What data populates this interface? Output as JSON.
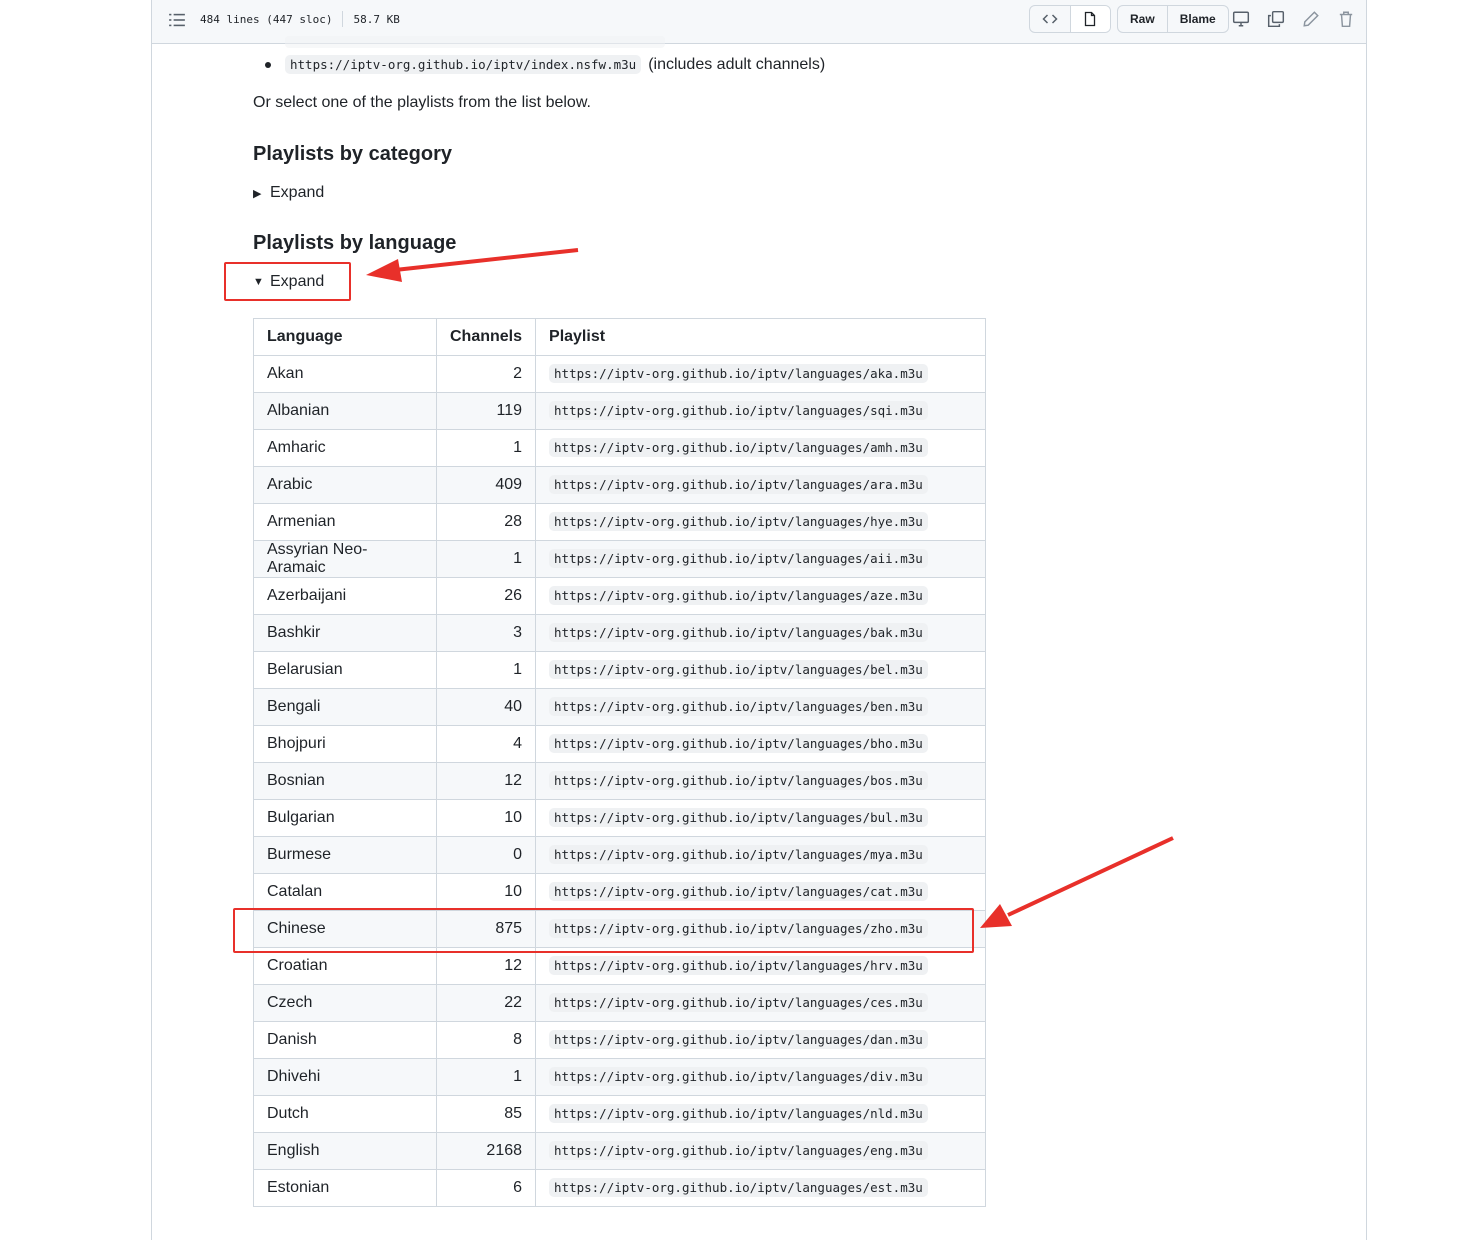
{
  "file_header": {
    "lines": "484 lines (447 sloc)",
    "size": "58.7 KB",
    "raw_label": "Raw",
    "blame_label": "Blame",
    "icons": [
      "list-icon",
      "code-icon",
      "file-icon",
      "desktop-icon",
      "copy-icon",
      "pencil-icon",
      "trash-icon"
    ]
  },
  "content": {
    "nsfw_url": "https://iptv-org.github.io/iptv/index.nsfw.m3u",
    "nsfw_note": "(includes adult channels)",
    "select_text": "Or select one of the playlists from the list below.",
    "category_heading": "Playlists by category",
    "category_expand": "Expand",
    "language_heading": "Playlists by language",
    "language_expand": "Expand"
  },
  "table": {
    "headers": [
      "Language",
      "Channels",
      "Playlist"
    ],
    "rows": [
      {
        "language": "Akan",
        "channels": "2",
        "url": "https://iptv-org.github.io/iptv/languages/aka.m3u"
      },
      {
        "language": "Albanian",
        "channels": "119",
        "url": "https://iptv-org.github.io/iptv/languages/sqi.m3u"
      },
      {
        "language": "Amharic",
        "channels": "1",
        "url": "https://iptv-org.github.io/iptv/languages/amh.m3u"
      },
      {
        "language": "Arabic",
        "channels": "409",
        "url": "https://iptv-org.github.io/iptv/languages/ara.m3u"
      },
      {
        "language": "Armenian",
        "channels": "28",
        "url": "https://iptv-org.github.io/iptv/languages/hye.m3u"
      },
      {
        "language": "Assyrian Neo-Aramaic",
        "channels": "1",
        "url": "https://iptv-org.github.io/iptv/languages/aii.m3u"
      },
      {
        "language": "Azerbaijani",
        "channels": "26",
        "url": "https://iptv-org.github.io/iptv/languages/aze.m3u"
      },
      {
        "language": "Bashkir",
        "channels": "3",
        "url": "https://iptv-org.github.io/iptv/languages/bak.m3u"
      },
      {
        "language": "Belarusian",
        "channels": "1",
        "url": "https://iptv-org.github.io/iptv/languages/bel.m3u"
      },
      {
        "language": "Bengali",
        "channels": "40",
        "url": "https://iptv-org.github.io/iptv/languages/ben.m3u"
      },
      {
        "language": "Bhojpuri",
        "channels": "4",
        "url": "https://iptv-org.github.io/iptv/languages/bho.m3u"
      },
      {
        "language": "Bosnian",
        "channels": "12",
        "url": "https://iptv-org.github.io/iptv/languages/bos.m3u"
      },
      {
        "language": "Bulgarian",
        "channels": "10",
        "url": "https://iptv-org.github.io/iptv/languages/bul.m3u"
      },
      {
        "language": "Burmese",
        "channels": "0",
        "url": "https://iptv-org.github.io/iptv/languages/mya.m3u"
      },
      {
        "language": "Catalan",
        "channels": "10",
        "url": "https://iptv-org.github.io/iptv/languages/cat.m3u"
      },
      {
        "language": "Chinese",
        "channels": "875",
        "url": "https://iptv-org.github.io/iptv/languages/zho.m3u"
      },
      {
        "language": "Croatian",
        "channels": "12",
        "url": "https://iptv-org.github.io/iptv/languages/hrv.m3u"
      },
      {
        "language": "Czech",
        "channels": "22",
        "url": "https://iptv-org.github.io/iptv/languages/ces.m3u"
      },
      {
        "language": "Danish",
        "channels": "8",
        "url": "https://iptv-org.github.io/iptv/languages/dan.m3u"
      },
      {
        "language": "Dhivehi",
        "channels": "1",
        "url": "https://iptv-org.github.io/iptv/languages/div.m3u"
      },
      {
        "language": "Dutch",
        "channels": "85",
        "url": "https://iptv-org.github.io/iptv/languages/nld.m3u"
      },
      {
        "language": "English",
        "channels": "2168",
        "url": "https://iptv-org.github.io/iptv/languages/eng.m3u"
      },
      {
        "language": "Estonian",
        "channels": "6",
        "url": "https://iptv-org.github.io/iptv/languages/est.m3u"
      }
    ]
  },
  "annotation_color": "#e8302a"
}
